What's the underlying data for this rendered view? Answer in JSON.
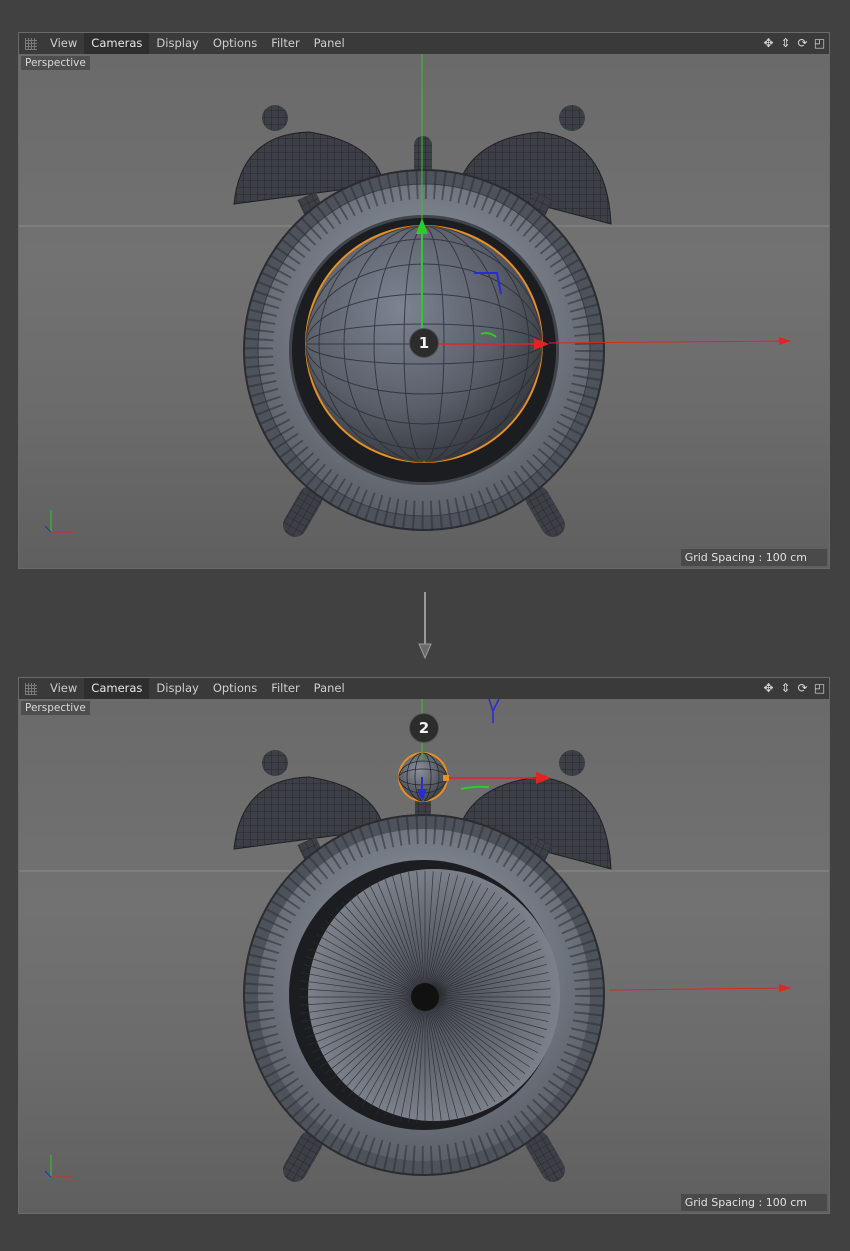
{
  "menu": [
    "View",
    "Cameras",
    "Display",
    "Options",
    "Filter",
    "Panel"
  ],
  "active_menu": "Cameras",
  "nav_icons": [
    "move-icon",
    "zoom-icon",
    "rotate-icon",
    "maximize-icon"
  ],
  "viewports": [
    {
      "label": "Perspective",
      "grid_spacing": "Grid Spacing : 100 cm",
      "step": "1"
    },
    {
      "label": "Perspective",
      "grid_spacing": "Grid Spacing : 100 cm",
      "step": "2"
    }
  ],
  "colors": {
    "x_axis": "#e02424",
    "y_axis": "#25d025",
    "z_axis": "#2a2ad8",
    "selection": "#e89020"
  }
}
